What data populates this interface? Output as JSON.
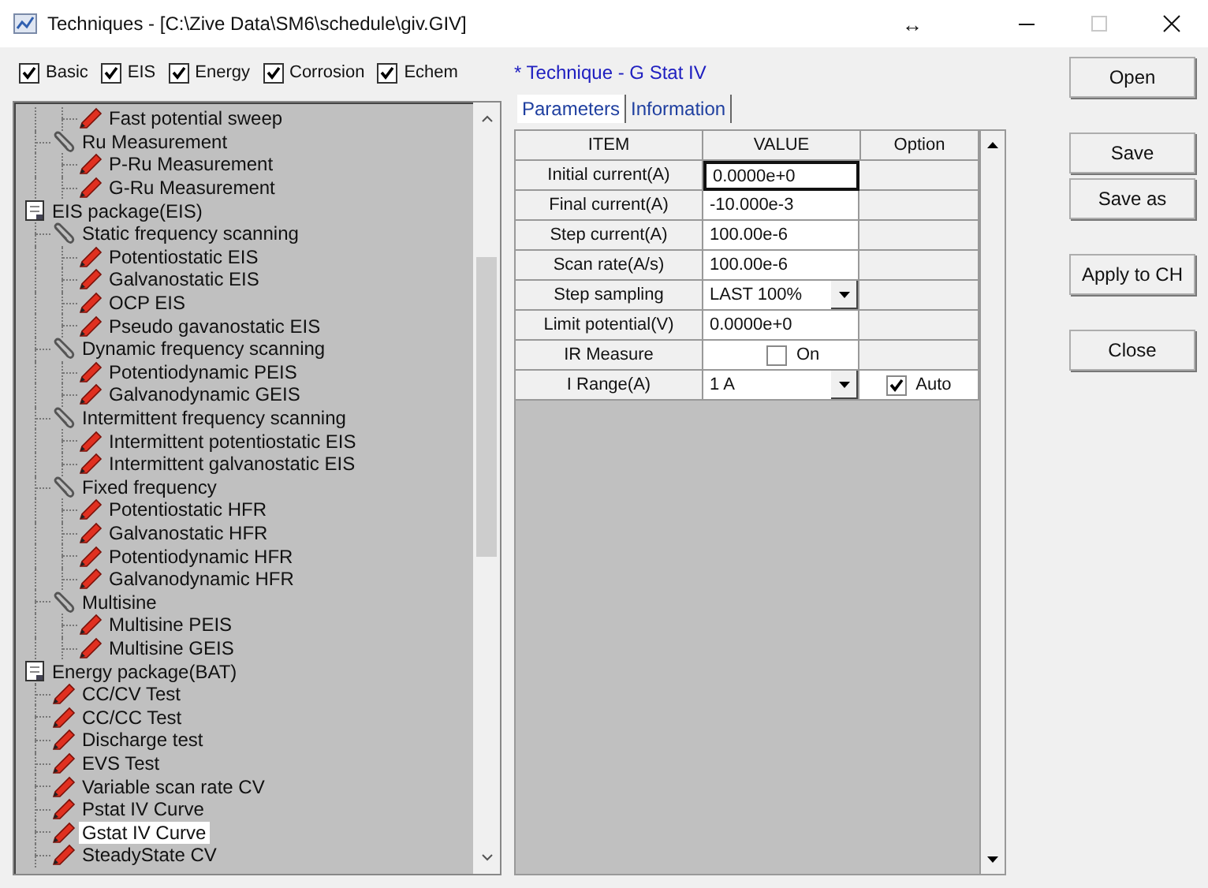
{
  "window": {
    "title": "Techniques - [C:\\Zive Data\\SM6\\schedule\\giv.GIV]",
    "resize_glyph": "↔",
    "maximize_disabled": true
  },
  "filters": [
    {
      "label": "Basic",
      "checked": true
    },
    {
      "label": "EIS",
      "checked": true
    },
    {
      "label": "Energy",
      "checked": true
    },
    {
      "label": "Corrosion",
      "checked": true
    },
    {
      "label": "Echem",
      "checked": true
    }
  ],
  "tree": [
    {
      "children": [
        {
          "children": [
            {
              "kind": "technique",
              "label": "Fast potential sweep",
              "selected": false
            }
          ]
        },
        {
          "kind": "group",
          "label": "Ru Measurement",
          "selected": false,
          "children": [
            {
              "kind": "technique",
              "label": "P-Ru Measurement",
              "selected": false
            },
            {
              "kind": "technique",
              "label": "G-Ru Measurement",
              "selected": false
            }
          ]
        }
      ]
    },
    {
      "kind": "package",
      "label": "EIS package(EIS)",
      "selected": false,
      "children": [
        {
          "kind": "group",
          "label": "Static frequency scanning",
          "selected": false,
          "children": [
            {
              "kind": "technique",
              "label": "Potentiostatic EIS",
              "selected": false
            },
            {
              "kind": "technique",
              "label": "Galvanostatic EIS",
              "selected": false
            },
            {
              "kind": "technique",
              "label": "OCP EIS",
              "selected": false
            },
            {
              "kind": "technique",
              "label": "Pseudo gavanostatic EIS",
              "selected": false
            }
          ]
        },
        {
          "kind": "group",
          "label": "Dynamic frequency scanning",
          "selected": false,
          "children": [
            {
              "kind": "technique",
              "label": "Potentiodynamic PEIS",
              "selected": false
            },
            {
              "kind": "technique",
              "label": "Galvanodynamic GEIS",
              "selected": false
            }
          ]
        },
        {
          "kind": "group",
          "label": "Intermittent frequency scanning",
          "selected": false,
          "children": [
            {
              "kind": "technique",
              "label": "Intermittent potentiostatic EIS",
              "selected": false
            },
            {
              "kind": "technique",
              "label": "Intermittent galvanostatic EIS",
              "selected": false
            }
          ]
        },
        {
          "kind": "group",
          "label": "Fixed frequency",
          "selected": false,
          "children": [
            {
              "kind": "technique",
              "label": "Potentiostatic HFR",
              "selected": false
            },
            {
              "kind": "technique",
              "label": "Galvanostatic HFR",
              "selected": false
            },
            {
              "kind": "technique",
              "label": "Potentiodynamic HFR",
              "selected": false
            },
            {
              "kind": "technique",
              "label": "Galvanodynamic HFR",
              "selected": false
            }
          ]
        },
        {
          "kind": "group",
          "label": "Multisine",
          "selected": false,
          "children": [
            {
              "kind": "technique",
              "label": "Multisine PEIS",
              "selected": false
            },
            {
              "kind": "technique",
              "label": "Multisine GEIS",
              "selected": false
            }
          ]
        }
      ]
    },
    {
      "kind": "package",
      "label": "Energy package(BAT)",
      "selected": false,
      "children": [
        {
          "kind": "technique",
          "label": "CC/CV Test",
          "selected": false
        },
        {
          "kind": "technique",
          "label": "CC/CC Test",
          "selected": false
        },
        {
          "kind": "technique",
          "label": "Discharge test",
          "selected": false
        },
        {
          "kind": "technique",
          "label": "EVS Test",
          "selected": false
        },
        {
          "kind": "technique",
          "label": "Variable scan rate CV",
          "selected": false
        },
        {
          "kind": "technique",
          "label": "Pstat IV Curve",
          "selected": false
        },
        {
          "kind": "technique",
          "label": "Gstat IV Curve",
          "selected": true
        },
        {
          "kind": "technique",
          "label": "SteadyState CV",
          "selected": false
        }
      ]
    }
  ],
  "technique_title": "* Technique - G Stat IV",
  "tabs": [
    {
      "label": "Parameters",
      "selected": true
    },
    {
      "label": "Information",
      "selected": false
    }
  ],
  "table": {
    "columns": [
      "ITEM",
      "VALUE",
      "Option"
    ],
    "rows": [
      {
        "item": "Initial current(A)",
        "value": {
          "kind": "text",
          "text": "0.0000e+0",
          "focused": true
        }
      },
      {
        "item": "Final current(A)",
        "value": {
          "kind": "text",
          "text": "-10.000e-3",
          "focused": false
        }
      },
      {
        "item": "Step current(A)",
        "value": {
          "kind": "text",
          "text": "100.00e-6",
          "focused": false
        }
      },
      {
        "item": "Scan rate(A/s)",
        "value": {
          "kind": "text",
          "text": "100.00e-6",
          "focused": false
        }
      },
      {
        "item": "Step sampling",
        "value": {
          "kind": "dropdown",
          "text": "LAST 100%",
          "focused": false
        }
      },
      {
        "item": "Limit potential(V)",
        "value": {
          "kind": "text",
          "text": "0.0000e+0",
          "focused": false
        }
      },
      {
        "item": "IR Measure",
        "value": {
          "kind": "checkbox",
          "text": "On",
          "checked": false,
          "focused": false
        }
      },
      {
        "item": "I Range(A)",
        "value": {
          "kind": "dropdown",
          "text": "1 A",
          "focused": false
        },
        "option": {
          "label": "Auto",
          "checked": true
        }
      }
    ]
  },
  "buttons": [
    {
      "label": "Open"
    },
    {
      "label": "Save"
    },
    {
      "label": "Save as"
    },
    {
      "label": "Apply to CH"
    },
    {
      "label": "Close"
    }
  ]
}
